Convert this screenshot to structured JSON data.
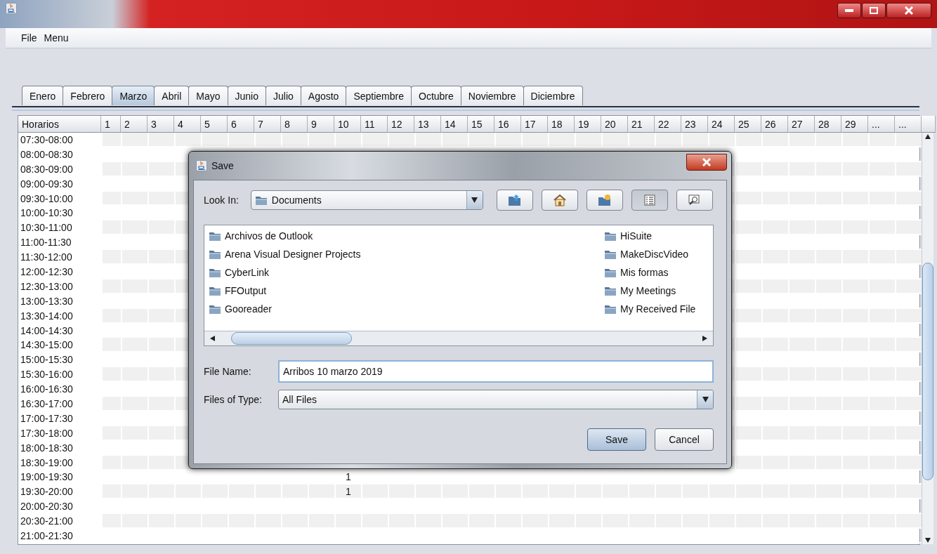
{
  "menu": [
    {
      "label": "File"
    },
    {
      "label": "Menu"
    }
  ],
  "tabs": [
    {
      "label": "Enero",
      "selected": false
    },
    {
      "label": "Febrero",
      "selected": false
    },
    {
      "label": "Marzo",
      "selected": true
    },
    {
      "label": "Abril",
      "selected": false
    },
    {
      "label": "Mayo",
      "selected": false
    },
    {
      "label": "Junio",
      "selected": false
    },
    {
      "label": "Julio",
      "selected": false
    },
    {
      "label": "Agosto",
      "selected": false
    },
    {
      "label": "Septiembre",
      "selected": false
    },
    {
      "label": "Octubre",
      "selected": false
    },
    {
      "label": "Noviembre",
      "selected": false
    },
    {
      "label": "Diciembre",
      "selected": false
    }
  ],
  "table": {
    "columns": [
      "Horarios",
      "1",
      "2",
      "3",
      "4",
      "5",
      "6",
      "7",
      "8",
      "9",
      "10",
      "11",
      "12",
      "13",
      "14",
      "15",
      "16",
      "17",
      "18",
      "19",
      "20",
      "21",
      "22",
      "23",
      "24",
      "25",
      "26",
      "27",
      "28",
      "29",
      "...",
      "..."
    ],
    "rows": [
      {
        "time": "07:30-08:00"
      },
      {
        "time": "08:00-08:30"
      },
      {
        "time": "08:30-09:00"
      },
      {
        "time": "09:00-09:30"
      },
      {
        "time": "09:30-10:00"
      },
      {
        "time": "10:00-10:30"
      },
      {
        "time": "10:30-11:00"
      },
      {
        "time": "11:00-11:30"
      },
      {
        "time": "11:30-12:00"
      },
      {
        "time": "12:00-12:30"
      },
      {
        "time": "12:30-13:00"
      },
      {
        "time": "13:00-13:30"
      },
      {
        "time": "13:30-14:00"
      },
      {
        "time": "14:00-14:30"
      },
      {
        "time": "14:30-15:00"
      },
      {
        "time": "15:00-15:30"
      },
      {
        "time": "15:30-16:00"
      },
      {
        "time": "16:00-16:30"
      },
      {
        "time": "16:30-17:00"
      },
      {
        "time": "17:00-17:30"
      },
      {
        "time": "17:30-18:00"
      },
      {
        "time": "18:00-18:30"
      },
      {
        "time": "18:30-19:00"
      },
      {
        "time": "19:00-19:30",
        "cells": [
          null,
          null,
          null,
          null,
          null,
          null,
          null,
          null,
          null,
          "1"
        ]
      },
      {
        "time": "19:30-20:00",
        "cells": [
          null,
          null,
          null,
          null,
          null,
          null,
          null,
          null,
          null,
          "1"
        ]
      },
      {
        "time": "20:00-20:30"
      },
      {
        "time": "20:30-21:00"
      },
      {
        "time": "21:00-21:30"
      }
    ]
  },
  "dialog": {
    "title": "Save",
    "look_in_label": "Look In:",
    "look_in": "Documents",
    "toolbar": [
      {
        "kind": "up",
        "selected": false
      },
      {
        "kind": "home",
        "selected": false
      },
      {
        "kind": "new-folder",
        "selected": false
      },
      {
        "kind": "list",
        "selected": true
      },
      {
        "kind": "details",
        "selected": false
      }
    ],
    "files": [
      {
        "name": "Archivos de Outlook"
      },
      {
        "name": "Arena Visual Designer Projects"
      },
      {
        "name": "CyberLink"
      },
      {
        "name": "FFOutput"
      },
      {
        "name": "Gooreader"
      },
      {
        "name": "HiSuite"
      },
      {
        "name": "MakeDiscVideo"
      },
      {
        "name": "Mis formas"
      },
      {
        "name": "My Meetings"
      },
      {
        "name": "My Received File"
      }
    ],
    "file_name_label": "File Name:",
    "file_name": "Arribos 10 marzo 2019",
    "file_type_label": "Files of Type:",
    "file_type": "All Files",
    "buttons": [
      {
        "label": "Save",
        "default": true
      },
      {
        "label": "Cancel",
        "default": false
      }
    ]
  }
}
